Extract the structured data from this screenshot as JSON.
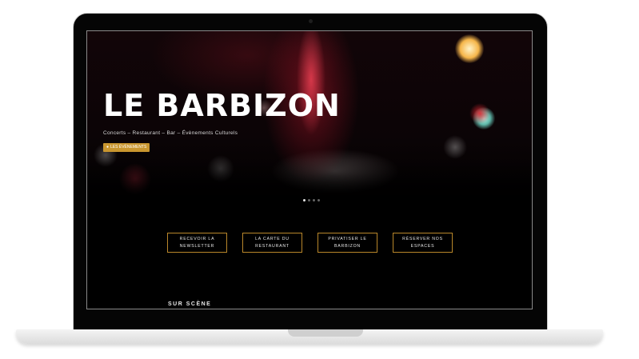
{
  "hero": {
    "title": "LE BARBIZON",
    "subtitle": "Concerts – Restaurant – Bar – Évènements Culturels",
    "events_button": "LES ÉVÈNEMENTS",
    "slider_total": 4,
    "slider_active": 1
  },
  "actions": [
    {
      "label": "RECEVOIR LA NEWSLETTER"
    },
    {
      "label": "LA CARTE DU RESTAURANT"
    },
    {
      "label": "PRIVATISER LE BARBIZON"
    },
    {
      "label": "RÉSERVER NOS ESPACES"
    }
  ],
  "section": {
    "title": "SUR SCÈNE"
  },
  "colors": {
    "accent": "#c9962f",
    "background": "#000000"
  }
}
